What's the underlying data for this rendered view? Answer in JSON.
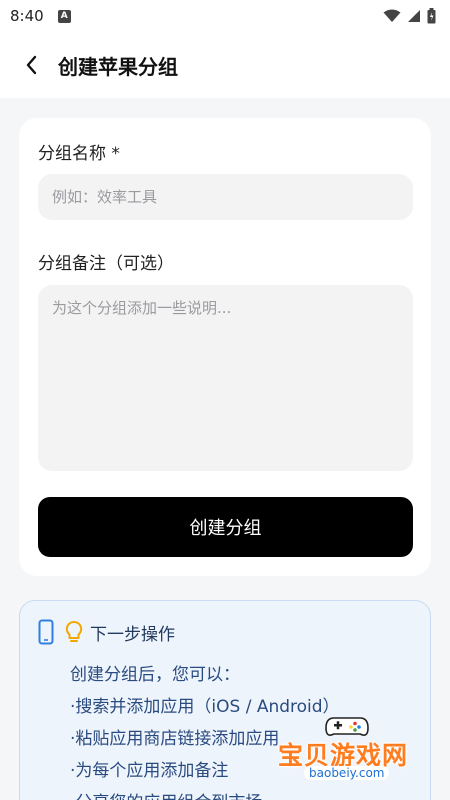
{
  "status_bar": {
    "time": "8:40",
    "notif_letter": "A"
  },
  "app_bar": {
    "title": "创建苹果分组"
  },
  "form": {
    "name_label": "分组名称 *",
    "name_placeholder": "例如：效率工具",
    "note_label": "分组备注（可选）",
    "note_placeholder": "为这个分组添加一些说明...",
    "submit_label": "创建分组"
  },
  "tips": {
    "title": "下一步操作",
    "lines": [
      "创建分组后，您可以：",
      "·搜索并添加应用（iOS / Android）",
      "·粘贴应用商店链接添加应用",
      "·为每个应用添加备注",
      "·分享您的应用组合到市场"
    ]
  },
  "watermark": {
    "text": "宝贝游戏网",
    "url": "baobeiy.com"
  },
  "colors": {
    "accent_button": "#000000",
    "tip_background": "#eef4fb",
    "tip_border": "#c8dcf2",
    "tip_text": "#2a4b80",
    "watermark_orange": "#ff7d1f",
    "watermark_blue": "#1e6fd4"
  },
  "icons": [
    "back-arrow-icon",
    "wifi-icon",
    "signal-icon",
    "battery-icon",
    "phone-icon",
    "lightbulb-icon",
    "gamepad-icon"
  ]
}
